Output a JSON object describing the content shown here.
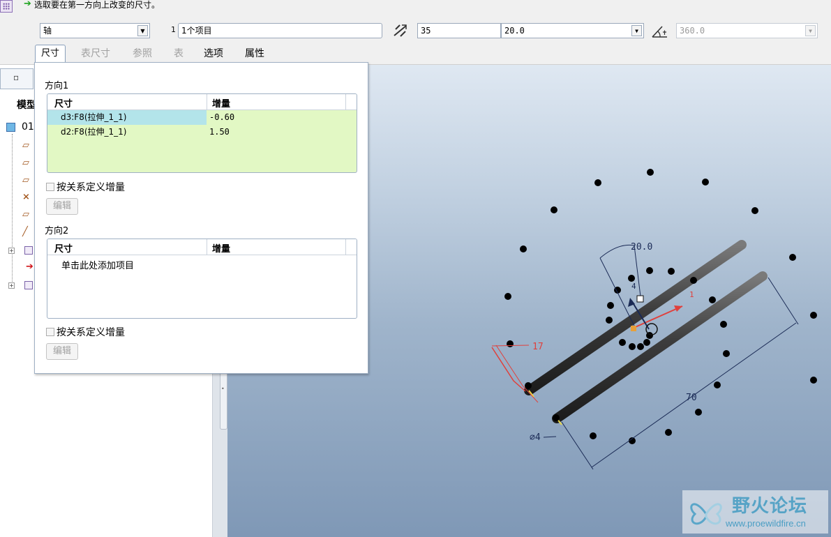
{
  "prompt": {
    "icon": "green-arrow-icon",
    "text": "选取要在第一方向上改变的尺寸。"
  },
  "toolbar": {
    "axis_select": "轴",
    "ref_index": "1",
    "ref_value": "1个项目",
    "count_value": "35",
    "increment_value": "20.0",
    "range_value": "360.0",
    "count_icon": "pattern-count-icon",
    "angle_icon": "angle-extent-icon"
  },
  "tabs": [
    {
      "label": "尺寸",
      "active": true
    },
    {
      "label": "表尺寸",
      "enabled": false
    },
    {
      "label": "参照",
      "enabled": false
    },
    {
      "label": "表",
      "enabled": false
    },
    {
      "label": "选项",
      "enabled": true
    },
    {
      "label": "属性",
      "enabled": true
    }
  ],
  "panel": {
    "direction1": {
      "title": "方向1",
      "headers": [
        "尺寸",
        "增量"
      ],
      "rows": [
        {
          "dim": "d3:F8(拉伸_1_1)",
          "incr": "-0.60"
        },
        {
          "dim": "d2:F8(拉伸_1_1)",
          "incr": "1.50"
        }
      ],
      "relation_label": "按关系定义增量",
      "edit_label": "编辑"
    },
    "direction2": {
      "title": "方向2",
      "headers": [
        "尺寸",
        "增量"
      ],
      "placeholder": "单击此处添加项目",
      "relation_label": "按关系定义增量",
      "edit_label": "编辑"
    }
  },
  "model_tree": {
    "header": "模型",
    "root_label": "01"
  },
  "canvas": {
    "dims": {
      "angle": "20.0",
      "length": "70",
      "diameter": "⌀4",
      "offset": "17",
      "d1": "4",
      "d2": "1"
    }
  },
  "watermark": {
    "title": "野火论坛",
    "url": "www.proewildfire.cn"
  },
  "colors": {
    "selected_row": "#b3e4ea",
    "grid_fill": "#e2f8c4",
    "canvas_top": "#dfe8f2",
    "canvas_bottom": "#7f98b6",
    "dim_line": "#1a2a55",
    "highlight": "#e0403c"
  }
}
